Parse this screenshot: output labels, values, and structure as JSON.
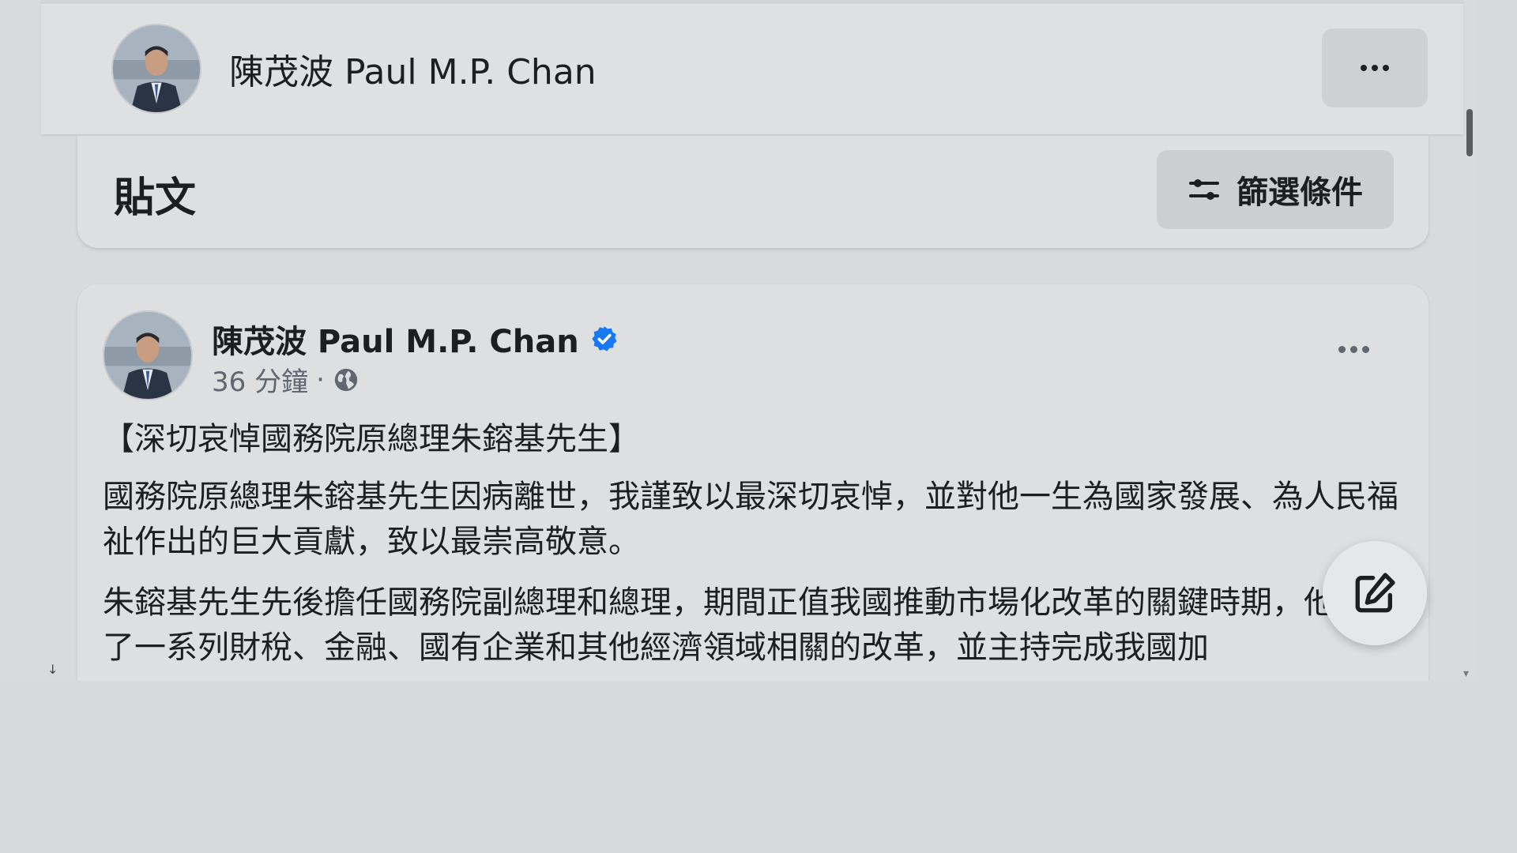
{
  "header": {
    "name": "陳茂波 Paul M.P. Chan",
    "more_icon": "ellipsis-icon"
  },
  "posts_section": {
    "title": "貼文",
    "filter_label": "篩選條件",
    "filter_icon": "sliders-icon"
  },
  "post": {
    "author": "陳茂波 Paul M.P. Chan",
    "verified_icon": "verified-badge-icon",
    "time": "36 分鐘",
    "separator": "·",
    "audience_icon": "globe-icon",
    "heading": "【深切哀悼國務院原總理朱鎔基先生】",
    "paragraphs": [
      "國務院原總理朱鎔基先生因病離世，我謹致以最深切哀悼，並對他一生為國家發展、為人民福祉作出的巨大貢獻，致以最崇高敬意。",
      "朱鎔基先生先後擔任國務院副總理和總理，期間正值我國推動市場化改革的關鍵時期，他推動了一系列財稅、金融、國有企業和其他經濟領域相關的改革，並主持完成我國加"
    ]
  },
  "fab": {
    "icon": "compose-icon"
  },
  "colors": {
    "verified": "#1877f2",
    "text": "#1c1e21",
    "secondary_text": "#606770"
  }
}
